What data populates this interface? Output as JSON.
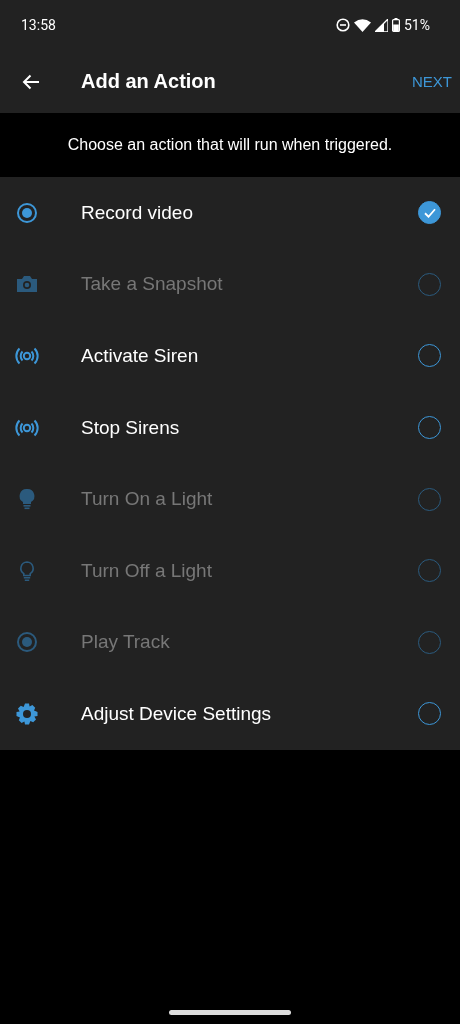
{
  "status_bar": {
    "time": "13:58",
    "battery": "51%"
  },
  "app_bar": {
    "title": "Add an Action",
    "action": "NEXT"
  },
  "subtitle": "Choose an action that will run when triggered.",
  "actions": [
    {
      "kind": "record",
      "label": "Record video",
      "disabled": false,
      "selected": true
    },
    {
      "kind": "camera",
      "label": "Take a Snapshot",
      "disabled": true,
      "selected": false
    },
    {
      "kind": "siren",
      "label": "Activate Siren",
      "disabled": false,
      "selected": false
    },
    {
      "kind": "siren",
      "label": "Stop Sirens",
      "disabled": false,
      "selected": false
    },
    {
      "kind": "bulbon",
      "label": "Turn On a Light",
      "disabled": true,
      "selected": false
    },
    {
      "kind": "bulboff",
      "label": "Turn Off a Light",
      "disabled": true,
      "selected": false
    },
    {
      "kind": "record",
      "label": "Play Track",
      "disabled": true,
      "selected": false
    },
    {
      "kind": "gear",
      "label": "Adjust Device Settings",
      "disabled": false,
      "selected": false
    }
  ]
}
